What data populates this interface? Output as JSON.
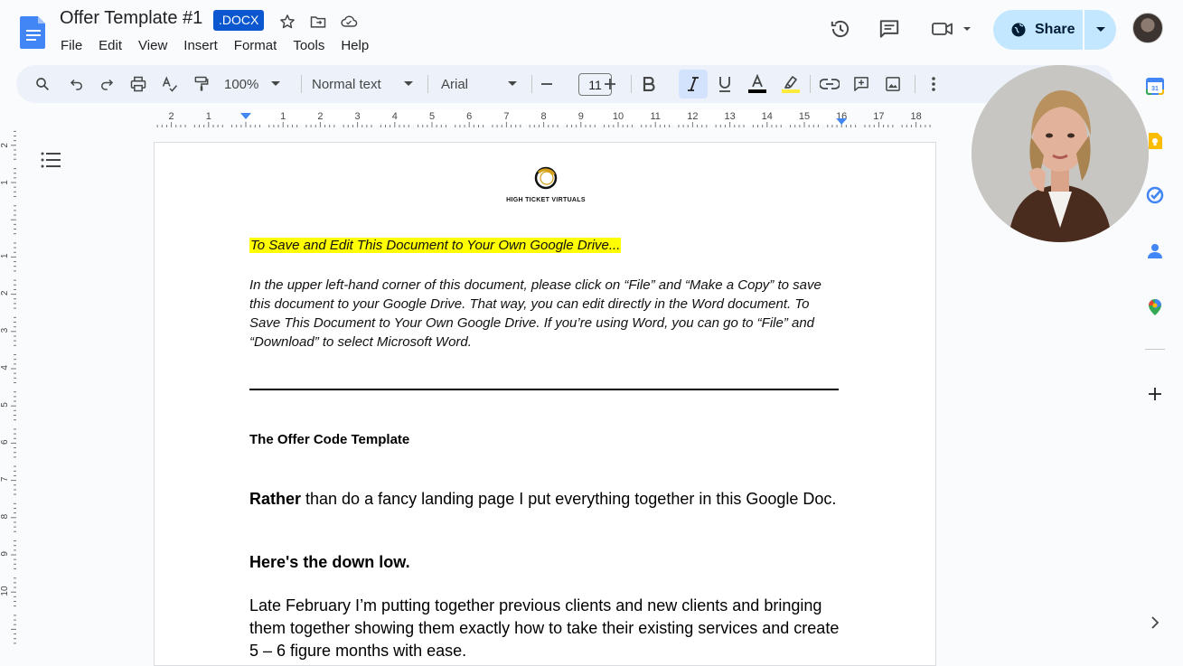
{
  "header": {
    "title": "Offer Template #1",
    "badge": ".DOCX",
    "title_icons": [
      "star-icon",
      "move-folder-icon",
      "cloud-saved-icon"
    ],
    "menu": [
      "File",
      "Edit",
      "View",
      "Insert",
      "Format",
      "Tools",
      "Help"
    ],
    "share_label": "Share",
    "right_icons": [
      "version-history-icon",
      "comments-icon",
      "meet-icon"
    ]
  },
  "toolbar": {
    "zoom": "100%",
    "style": "Normal text",
    "font": "Arial",
    "font_size": "11",
    "text_color": "#000000",
    "highlight_color": "#ffeb3b"
  },
  "ruler": {
    "h_labels": [
      "2",
      "1",
      "1",
      "2",
      "3",
      "4",
      "5",
      "6",
      "7",
      "8",
      "9",
      "10",
      "11",
      "12",
      "13",
      "14",
      "15",
      "16",
      "17",
      "18"
    ],
    "v_labels": [
      "2",
      "1",
      "1",
      "2",
      "3",
      "4",
      "5",
      "6",
      "7",
      "8",
      "9",
      "10"
    ]
  },
  "document": {
    "logo_text": "HIGH TICKET VIRTUALS",
    "highlight_line": "To Save and Edit This Document to Your Own Google Drive...",
    "instructions": "In the upper left-hand corner of this document, please click on “File” and “Make a Copy” to save this document to your Google Drive. That way, you can edit directly in the Word document.  To Save This Document to Your Own Google Drive. If you’re using Word, you can go to “File” and “Download” to select Microsoft Word.",
    "heading": "The Offer  Code Template",
    "para_bold": "Rather",
    "para_rest": " than do a fancy landing page I put everything together in this Google Doc.",
    "subheading": "Here's the down low.",
    "para3": "Late February I’m putting together previous clients and new clients and bringing them together showing them exactly how to take their existing services and create 5 – 6 figure months with ease."
  },
  "side_panel": [
    "calendar-icon",
    "keep-icon",
    "tasks-icon",
    "contacts-icon",
    "maps-icon",
    "add-icon",
    "expand-icon"
  ],
  "colors": {
    "accent": "#0b57d0",
    "share_bg": "#c2e7ff",
    "toolbar_bg": "#edf2fa",
    "highlight": "#ffff00"
  }
}
